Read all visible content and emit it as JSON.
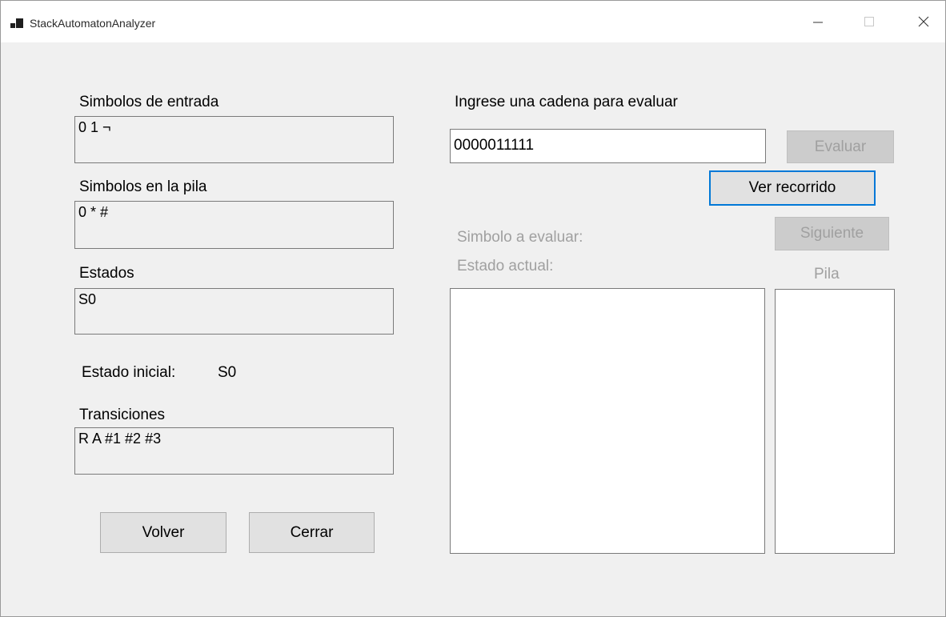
{
  "window": {
    "title": "StackAutomatonAnalyzer"
  },
  "left": {
    "input_symbols_label": "Simbolos de entrada",
    "input_symbols_value": "0 1 ¬",
    "stack_symbols_label": "Simbolos en la pila",
    "stack_symbols_value": "0 * #",
    "states_label": "Estados",
    "states_value": "S0",
    "initial_state_label": "Estado inicial:",
    "initial_state_value": "S0",
    "transitions_label": "Transiciones",
    "transitions_value": "R A #1 #2 #3",
    "back_button": "Volver",
    "close_button": "Cerrar"
  },
  "right": {
    "prompt_label": "Ingrese una cadena para evaluar",
    "string_input_value": "0000011111",
    "evaluate_button": "Evaluar",
    "view_path_button": "Ver recorrido",
    "symbol_to_evaluate_label": "Simbolo a evaluar:",
    "next_button": "Siguiente",
    "current_state_label": "Estado actual:",
    "stack_label": "Pila"
  },
  "colors": {
    "window_bg": "#f0f0f0",
    "focus_accent": "#0078d7",
    "disabled_text": "#a0a0a0"
  },
  "icons": {
    "app": "app-icon",
    "minimize": "minimize-icon",
    "maximize": "maximize-icon",
    "close": "close-icon"
  }
}
